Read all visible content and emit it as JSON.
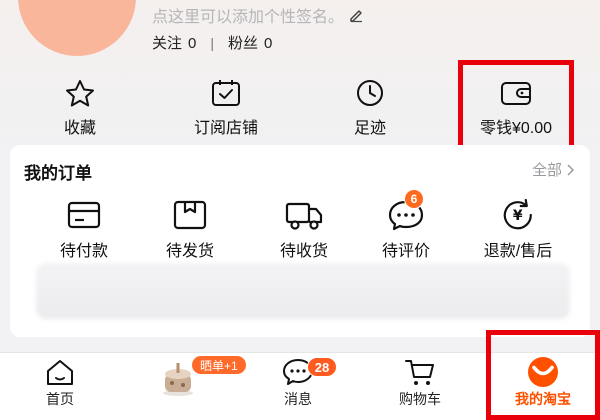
{
  "profile": {
    "signature_placeholder": "点这里可以添加个性签名。",
    "following_label": "关注",
    "following_count": "0",
    "separator": "|",
    "followers_label": "粉丝",
    "followers_count": "0"
  },
  "quick_actions": [
    {
      "label": "收藏",
      "icon": "star-icon"
    },
    {
      "label": "订阅店铺",
      "icon": "subscribe-check-icon"
    },
    {
      "label": "足迹",
      "icon": "clock-icon"
    },
    {
      "label": "零钱¥0.00",
      "icon": "wallet-icon"
    }
  ],
  "orders": {
    "title": "我的订单",
    "all_link": "全部",
    "items": [
      {
        "label": "待付款",
        "icon": "card-icon"
      },
      {
        "label": "待发货",
        "icon": "box-icon"
      },
      {
        "label": "待收货",
        "icon": "truck-icon"
      },
      {
        "label": "待评价",
        "icon": "chat-icon",
        "badge": "6"
      },
      {
        "label": "退款/售后",
        "icon": "refund-icon"
      }
    ]
  },
  "tabbar": [
    {
      "label": "首页",
      "icon": "home-icon"
    },
    {
      "label": "",
      "icon": "cake-post-icon",
      "badge": "晒单+1"
    },
    {
      "label": "消息",
      "icon": "message-icon",
      "badge": "28"
    },
    {
      "label": "购物车",
      "icon": "cart-icon"
    },
    {
      "label": "我的淘宝",
      "icon": "taobao-face-icon",
      "active": true
    }
  ],
  "colors": {
    "accent": "#ff5000",
    "highlight_box": "#e8000b",
    "badge": "#ff5a1f"
  }
}
